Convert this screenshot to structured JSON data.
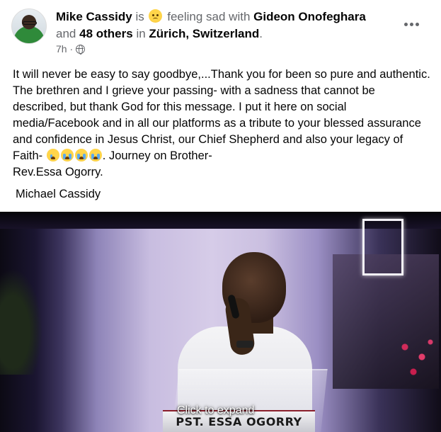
{
  "header": {
    "author": "Mike Cassidy",
    "is_text": "is",
    "feeling_icon": "sad-face-emoji",
    "feeling_text": "feeling sad with",
    "tagged_user": "Gideon Onofeghara",
    "and_text": "and",
    "others_text": "48 others",
    "in_text": "in",
    "location": "Zürich, Switzerland",
    "period": ".",
    "timestamp": "7h ·",
    "privacy_icon": "globe-icon",
    "more_icon": "more-options-icon"
  },
  "post": {
    "text_part1": "It will never be easy to say goodbye,...Thank you for been so pure and authentic. The brethren and I grieve your passing- with a sadness that cannot be described,  but thank God for this message. I put it here on social media/Facebook and in all our platforms as a tribute to your blessed assurance and confidence in Jesus Christ, our Chief Shepherd and also your legacy of Faith-",
    "text_part2": ". Journey on Brother-",
    "text_line2": "Rev.Essa Ogorry.",
    "signature": "Michael Cassidy",
    "emojis": [
      "crying-face-emoji",
      "loudly-crying-face-emoji",
      "loudly-crying-face-emoji",
      "loudly-crying-face-emoji"
    ]
  },
  "video": {
    "expand_label": "Click to expand",
    "caption": "PST. ESSA OGORRY"
  }
}
